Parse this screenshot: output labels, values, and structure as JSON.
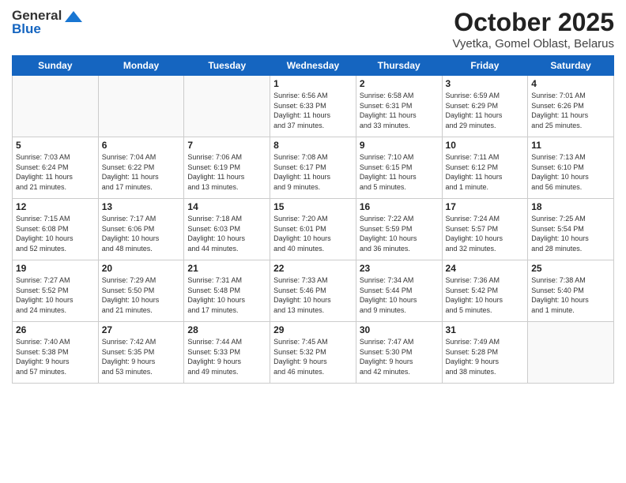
{
  "header": {
    "logo_general": "General",
    "logo_blue": "Blue",
    "month_title": "October 2025",
    "location": "Vyetka, Gomel Oblast, Belarus"
  },
  "days_of_week": [
    "Sunday",
    "Monday",
    "Tuesday",
    "Wednesday",
    "Thursday",
    "Friday",
    "Saturday"
  ],
  "weeks": [
    [
      {
        "num": "",
        "info": ""
      },
      {
        "num": "",
        "info": ""
      },
      {
        "num": "",
        "info": ""
      },
      {
        "num": "1",
        "info": "Sunrise: 6:56 AM\nSunset: 6:33 PM\nDaylight: 11 hours\nand 37 minutes."
      },
      {
        "num": "2",
        "info": "Sunrise: 6:58 AM\nSunset: 6:31 PM\nDaylight: 11 hours\nand 33 minutes."
      },
      {
        "num": "3",
        "info": "Sunrise: 6:59 AM\nSunset: 6:29 PM\nDaylight: 11 hours\nand 29 minutes."
      },
      {
        "num": "4",
        "info": "Sunrise: 7:01 AM\nSunset: 6:26 PM\nDaylight: 11 hours\nand 25 minutes."
      }
    ],
    [
      {
        "num": "5",
        "info": "Sunrise: 7:03 AM\nSunset: 6:24 PM\nDaylight: 11 hours\nand 21 minutes."
      },
      {
        "num": "6",
        "info": "Sunrise: 7:04 AM\nSunset: 6:22 PM\nDaylight: 11 hours\nand 17 minutes."
      },
      {
        "num": "7",
        "info": "Sunrise: 7:06 AM\nSunset: 6:19 PM\nDaylight: 11 hours\nand 13 minutes."
      },
      {
        "num": "8",
        "info": "Sunrise: 7:08 AM\nSunset: 6:17 PM\nDaylight: 11 hours\nand 9 minutes."
      },
      {
        "num": "9",
        "info": "Sunrise: 7:10 AM\nSunset: 6:15 PM\nDaylight: 11 hours\nand 5 minutes."
      },
      {
        "num": "10",
        "info": "Sunrise: 7:11 AM\nSunset: 6:12 PM\nDaylight: 11 hours\nand 1 minute."
      },
      {
        "num": "11",
        "info": "Sunrise: 7:13 AM\nSunset: 6:10 PM\nDaylight: 10 hours\nand 56 minutes."
      }
    ],
    [
      {
        "num": "12",
        "info": "Sunrise: 7:15 AM\nSunset: 6:08 PM\nDaylight: 10 hours\nand 52 minutes."
      },
      {
        "num": "13",
        "info": "Sunrise: 7:17 AM\nSunset: 6:06 PM\nDaylight: 10 hours\nand 48 minutes."
      },
      {
        "num": "14",
        "info": "Sunrise: 7:18 AM\nSunset: 6:03 PM\nDaylight: 10 hours\nand 44 minutes."
      },
      {
        "num": "15",
        "info": "Sunrise: 7:20 AM\nSunset: 6:01 PM\nDaylight: 10 hours\nand 40 minutes."
      },
      {
        "num": "16",
        "info": "Sunrise: 7:22 AM\nSunset: 5:59 PM\nDaylight: 10 hours\nand 36 minutes."
      },
      {
        "num": "17",
        "info": "Sunrise: 7:24 AM\nSunset: 5:57 PM\nDaylight: 10 hours\nand 32 minutes."
      },
      {
        "num": "18",
        "info": "Sunrise: 7:25 AM\nSunset: 5:54 PM\nDaylight: 10 hours\nand 28 minutes."
      }
    ],
    [
      {
        "num": "19",
        "info": "Sunrise: 7:27 AM\nSunset: 5:52 PM\nDaylight: 10 hours\nand 24 minutes."
      },
      {
        "num": "20",
        "info": "Sunrise: 7:29 AM\nSunset: 5:50 PM\nDaylight: 10 hours\nand 21 minutes."
      },
      {
        "num": "21",
        "info": "Sunrise: 7:31 AM\nSunset: 5:48 PM\nDaylight: 10 hours\nand 17 minutes."
      },
      {
        "num": "22",
        "info": "Sunrise: 7:33 AM\nSunset: 5:46 PM\nDaylight: 10 hours\nand 13 minutes."
      },
      {
        "num": "23",
        "info": "Sunrise: 7:34 AM\nSunset: 5:44 PM\nDaylight: 10 hours\nand 9 minutes."
      },
      {
        "num": "24",
        "info": "Sunrise: 7:36 AM\nSunset: 5:42 PM\nDaylight: 10 hours\nand 5 minutes."
      },
      {
        "num": "25",
        "info": "Sunrise: 7:38 AM\nSunset: 5:40 PM\nDaylight: 10 hours\nand 1 minute."
      }
    ],
    [
      {
        "num": "26",
        "info": "Sunrise: 7:40 AM\nSunset: 5:38 PM\nDaylight: 9 hours\nand 57 minutes."
      },
      {
        "num": "27",
        "info": "Sunrise: 7:42 AM\nSunset: 5:35 PM\nDaylight: 9 hours\nand 53 minutes."
      },
      {
        "num": "28",
        "info": "Sunrise: 7:44 AM\nSunset: 5:33 PM\nDaylight: 9 hours\nand 49 minutes."
      },
      {
        "num": "29",
        "info": "Sunrise: 7:45 AM\nSunset: 5:32 PM\nDaylight: 9 hours\nand 46 minutes."
      },
      {
        "num": "30",
        "info": "Sunrise: 7:47 AM\nSunset: 5:30 PM\nDaylight: 9 hours\nand 42 minutes."
      },
      {
        "num": "31",
        "info": "Sunrise: 7:49 AM\nSunset: 5:28 PM\nDaylight: 9 hours\nand 38 minutes."
      },
      {
        "num": "",
        "info": ""
      }
    ]
  ]
}
